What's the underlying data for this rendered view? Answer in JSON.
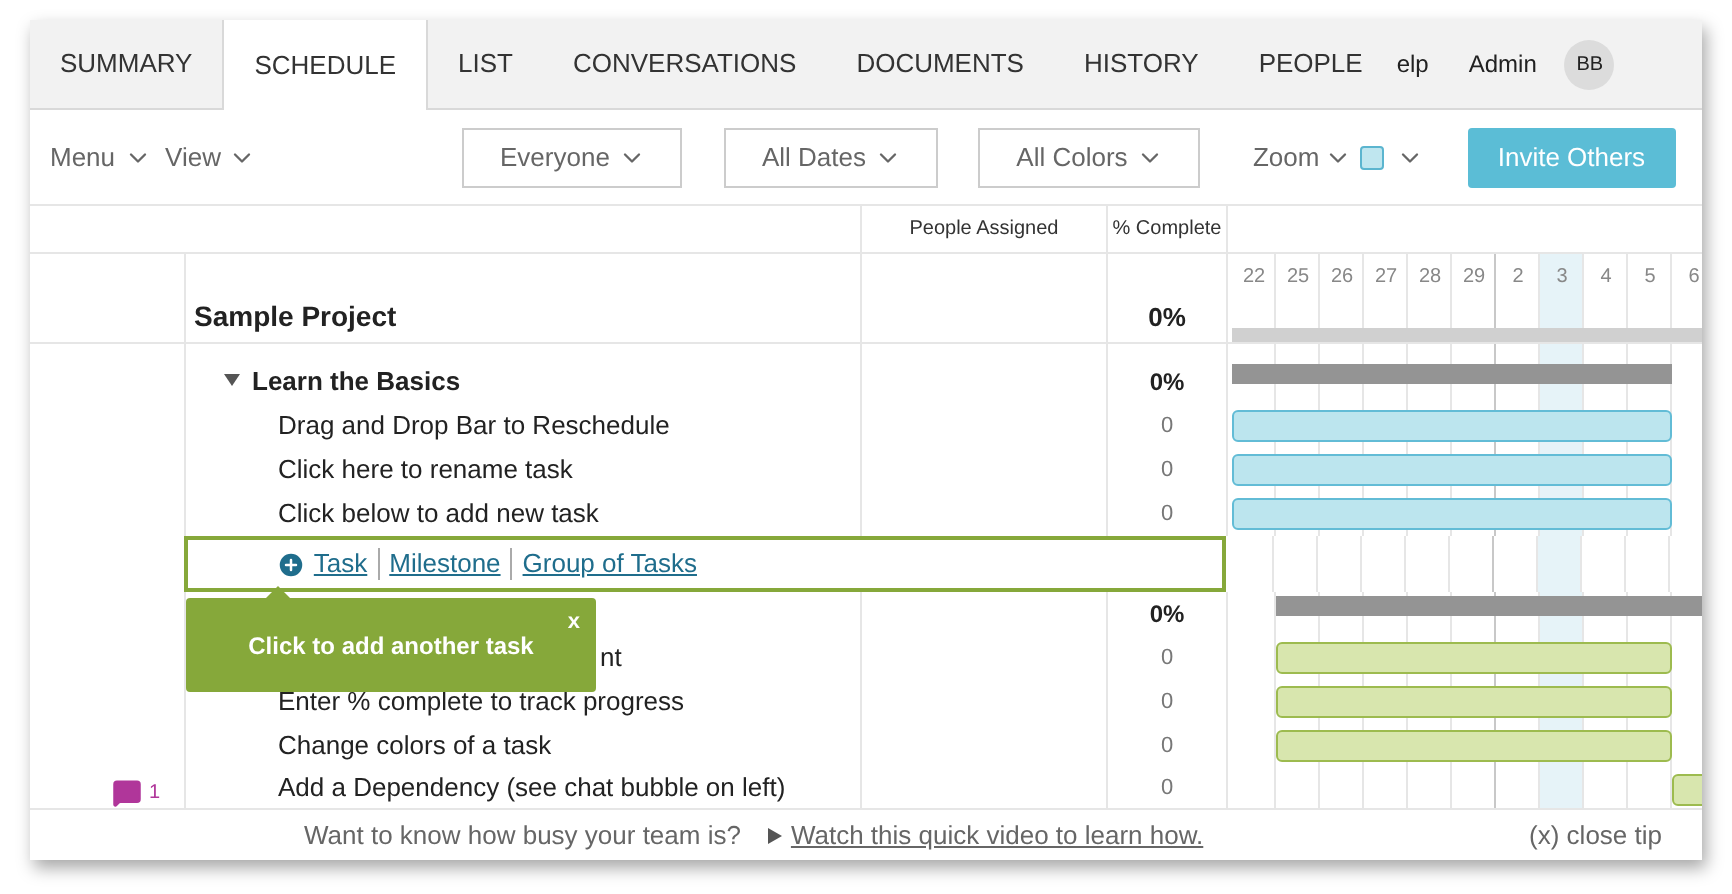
{
  "tabs": [
    {
      "label": "SUMMARY",
      "selected": false
    },
    {
      "label": "SCHEDULE",
      "selected": true
    },
    {
      "label": "LIST",
      "selected": false
    },
    {
      "label": "CONVERSATIONS",
      "selected": false
    },
    {
      "label": "DOCUMENTS",
      "selected": false
    },
    {
      "label": "HISTORY",
      "selected": false
    },
    {
      "label": "PEOPLE",
      "selected": false
    }
  ],
  "user": {
    "help": "elp",
    "role": "Admin",
    "initials": "BB"
  },
  "toolbar": {
    "menu": "Menu",
    "view": "View",
    "filters": [
      "Everyone",
      "All Dates",
      "All Colors"
    ],
    "zoom": "Zoom",
    "invite": "Invite Others"
  },
  "columns": {
    "people": "People Assigned",
    "complete": "% Complete"
  },
  "days": [
    {
      "label": "22",
      "today": false
    },
    {
      "label": "25",
      "today": false
    },
    {
      "label": "26",
      "today": false
    },
    {
      "label": "27",
      "today": false
    },
    {
      "label": "28",
      "today": false
    },
    {
      "label": "29",
      "today": false
    },
    {
      "label": "2",
      "today": false
    },
    {
      "label": "3",
      "today": true
    },
    {
      "label": "4",
      "today": false
    },
    {
      "label": "5",
      "today": false
    },
    {
      "label": "6",
      "today": false
    }
  ],
  "project": {
    "name": "Sample Project",
    "complete": "0%"
  },
  "groups": [
    {
      "name": "Learn the Basics",
      "expanded": true,
      "complete": "0%",
      "tasks": [
        {
          "name": "Drag and Drop Bar to Reschedule",
          "complete": "0",
          "color": "#bce5ee"
        },
        {
          "name": "Click here to rename task",
          "complete": "0",
          "color": "#bce5ee"
        },
        {
          "name": "Click below to add new task",
          "complete": "0",
          "color": "#bce5ee"
        }
      ]
    },
    {
      "complete": "0%",
      "tasks": [
        {
          "name": "nt",
          "complete": "0",
          "color": "#d8e6ae"
        },
        {
          "name": "Enter % complete to track progress",
          "complete": "0",
          "color": "#d8e6ae"
        },
        {
          "name": "Change colors of a task",
          "complete": "0",
          "color": "#d8e6ae"
        },
        {
          "name": "Add a Dependency (see chat bubble on left)",
          "complete": "0",
          "color": "#d8e6ae",
          "comments": "1"
        }
      ]
    }
  ],
  "add_row": {
    "links": [
      "Task",
      "Milestone",
      "Group of Tasks"
    ]
  },
  "tooltip": {
    "text": "Click to add another task",
    "close": "x"
  },
  "footer": {
    "question": "Want to know how busy your team is?",
    "link": "Watch this quick video to learn how.",
    "close": "(x) close tip"
  }
}
